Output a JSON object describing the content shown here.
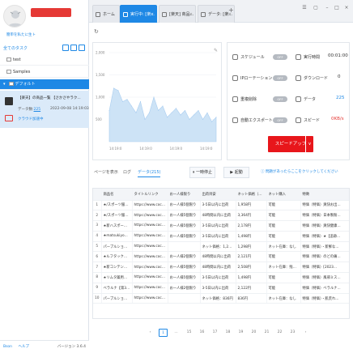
{
  "sidebar": {
    "user_sub_prefix": "簡単を私たに生",
    "user_sub_link": "ト",
    "task_header": "全てのタスク",
    "tree": [
      {
        "label": "test"
      },
      {
        "label": "Samples"
      },
      {
        "label": "デフォルト"
      }
    ],
    "task": {
      "name": "【楽天】の商品一覧 【さかさやラク...",
      "count_label": "データ数:",
      "count": "225",
      "date": "2022-09-08 14:19:03",
      "status": "クラウド加速中"
    },
    "footer": {
      "link1": "Bson",
      "link2": "ヘルプ",
      "version": "バージョン 3.6.4"
    }
  },
  "tabs": [
    {
      "label": "ホーム"
    },
    {
      "label": "実行中: [楽..."
    },
    {
      "label": "[楽天] 商品..."
    },
    {
      "label": "データ: [楽..."
    }
  ],
  "chart_data": {
    "type": "area",
    "title": "",
    "xlabel": "",
    "ylabel": "",
    "y_ticks": [
      "2,000",
      "1,500",
      "1,000",
      "500"
    ],
    "x_ticks": [
      "14:19:0",
      "14:19:0",
      "14:19:0",
      "14:19:0"
    ],
    "ylim": [
      0,
      2000
    ],
    "x": [
      0,
      1,
      2,
      3,
      4,
      5,
      6,
      7,
      8,
      9,
      10,
      11,
      12,
      13,
      14,
      15,
      16,
      17,
      18,
      19,
      20,
      21,
      22,
      23,
      24
    ],
    "values": [
      700,
      1200,
      1150,
      900,
      950,
      800,
      650,
      900,
      500,
      650,
      1000,
      700,
      800,
      550,
      650,
      750,
      600,
      700,
      500,
      600,
      700,
      500,
      650,
      450,
      550
    ],
    "grid": true,
    "color": "#cde3f6"
  },
  "options": {
    "schedule": {
      "label": "スケジュール",
      "toggle": "OFF"
    },
    "runtime": {
      "label": "実行時間",
      "value": "00:01:00"
    },
    "ip_rotation": {
      "label": "IPローテーション",
      "toggle": "OFF"
    },
    "download": {
      "label": "ダウンロード",
      "value": "0"
    },
    "dedup": {
      "label": "重複削除",
      "toggle": "OFF"
    },
    "data": {
      "label": "データ",
      "value": "225"
    },
    "auto_export": {
      "label": "自動エクスポート",
      "toggle": "OFF"
    },
    "speed": {
      "label": "スピード",
      "value": "0KB/s"
    },
    "speedup_label": "スピードアップ"
  },
  "bottom_bar": {
    "tab_page": "ページを表示",
    "tab_log": "ログ",
    "tab_data": "データ(215)",
    "stop": "一時停止",
    "start": "起動",
    "help": "問題があったらここをクリックしてください"
  },
  "table": {
    "headers": [
      "",
      "商品名",
      "タイトルリンク",
      "お一人様限り",
      "出荷目安",
      "ネット価格（税込）",
      "ネット購入",
      "特徴"
    ],
    "rows": [
      [
        "1",
        "★/スポーツ服ロカブ...",
        "https://www.cocokarafi...",
        "お一人様5個限り",
        "3-5日以内に出荷",
        "1,958円",
        "可能",
        "特価（特価）爽快お出..."
      ],
      [
        "2",
        "★/スポーツ服女性ト...",
        "https://www.cocokarafi...",
        "お一人様5個限り",
        "48時間以内に出荷",
        "3,364円",
        "可能",
        "特価（特価）日本製粉..."
      ],
      [
        "3",
        "★新ハスポーツ毛皮ケ...",
        "https://www.cocokarafi...",
        "お一人様5個限り",
        "3-5日以内に出荷",
        "2,178円",
        "可能",
        "特価（特価）爽快健康..."
      ],
      [
        "4",
        "★matsukiyo...",
        "https://www.cocokarafi...",
        "お一人様5個限り",
        "3-5日以内に出荷",
        "1,498円",
        "可能",
        "特価（特価）★【追跡..."
      ],
      [
        "5",
        "パーブルショットブラ...",
        "https://www.cocokarafi...",
        "",
        "ネット価格：1,298円",
        "1,298円",
        "ネット在庫：なし",
        "特価（特価）・新鮮な..."
      ],
      [
        "6",
        "★ルフタックＫ24...",
        "https://www.cocokarafi...",
        "お一人様2個限り",
        "48時間以内に出荷",
        "2,121円",
        "可能",
        "特価（特価）のどの痛..."
      ],
      [
        "7",
        "★新コンテンツセール...",
        "https://www.cocokarafi...",
        "お一人様5個限り",
        "48時間以内に出荷",
        "2,508円",
        "ネット在庫：残りわず",
        "特価（特価）[2023..."
      ],
      [
        "8",
        "★リムタ薬用内服液...",
        "https://www.cocokarafi...",
        "お一人様5個限り",
        "3-5日以内に出荷",
        "1,498円",
        "可能",
        "特価（特価）風邪ミス..."
      ],
      [
        "9",
        "ベラルナ【第3類医...",
        "https://www.cocokarafi...",
        "お一人様2個限り",
        "3-5日以内に出荷",
        "2,122円",
        "可能",
        "特価（特価）ベラルナ..."
      ],
      [
        "10",
        "パーブルショットブラ...",
        "https://www.cocokarafi...",
        "",
        "ネット価格：836円",
        "836円",
        "ネット在庫：なし",
        "特価（特価）・肌荒れ..."
      ]
    ]
  },
  "pager": [
    "‹",
    "1",
    "...",
    "15",
    "16",
    "17",
    "18",
    "19",
    "20",
    "21",
    "22",
    "23",
    "›"
  ]
}
